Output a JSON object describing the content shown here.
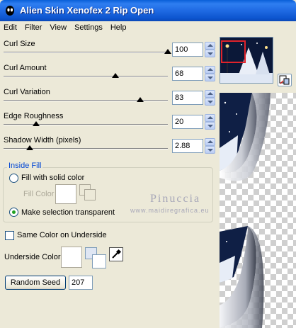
{
  "window": {
    "title": "Alien Skin Xenofex 2 Rip Open"
  },
  "menu": [
    "Edit",
    "Filter",
    "View",
    "Settings",
    "Help"
  ],
  "sliders": [
    {
      "label": "Curl Size",
      "value": "100",
      "fraction": 1.0
    },
    {
      "label": "Curl Amount",
      "value": "68",
      "fraction": 0.68
    },
    {
      "label": "Curl Variation",
      "value": "83",
      "fraction": 0.83
    },
    {
      "label": "Edge Roughness",
      "value": "20",
      "fraction": 0.2
    },
    {
      "label": "Shadow Width (pixels)",
      "value": "2.88",
      "fraction": 0.16
    }
  ],
  "inside_fill": {
    "title": "Inside Fill",
    "fill_solid_label": "Fill with solid color",
    "fill_color_label": "Fill Color",
    "transparent_label": "Make selection transparent",
    "selected": "transparent"
  },
  "same_color_label": "Same Color on Underside",
  "same_color_checked": false,
  "underside_color_label": "Underside Color",
  "random_seed": {
    "button_label": "Random Seed",
    "value": "207"
  },
  "watermark": {
    "main": "Pinuccia",
    "sub": "www.maidiregrafica.eu"
  },
  "colors": {
    "titlebar": "#0a5fd8",
    "accent_text": "#0046d5",
    "preview_night": "#0b1838",
    "thumb_frame": "#e0232b"
  },
  "icons": {
    "app": "alien-skin-icon",
    "dropper": "eyedropper-icon",
    "reset": "reset-view-icon"
  }
}
